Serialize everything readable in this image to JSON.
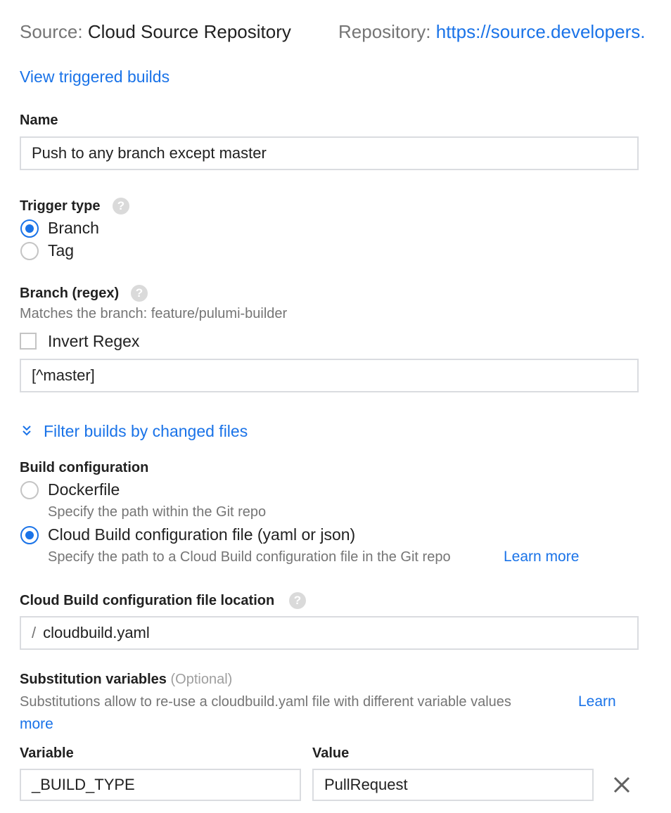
{
  "source": {
    "label": "Source:",
    "value": "Cloud Source Repository",
    "repo_label": "Repository:",
    "repo_link": "https://source.developers."
  },
  "view_builds_link": "View triggered builds",
  "name": {
    "label": "Name",
    "value": "Push to any branch except master"
  },
  "trigger_type": {
    "label": "Trigger type",
    "options": [
      {
        "label": "Branch",
        "selected": true
      },
      {
        "label": "Tag",
        "selected": false
      }
    ]
  },
  "branch": {
    "label": "Branch (regex)",
    "matches": "Matches the branch: feature/pulumi-builder",
    "invert_label": "Invert Regex",
    "invert_checked": false,
    "value": "[^master]"
  },
  "filter_link": "Filter builds by changed files",
  "build_config": {
    "label": "Build configuration",
    "options": [
      {
        "label": "Dockerfile",
        "description": "Specify the path within the Git repo",
        "selected": false
      },
      {
        "label": "Cloud Build configuration file (yaml or json)",
        "description": "Specify the path to a Cloud Build configuration file in the Git repo",
        "selected": true
      }
    ],
    "learn_more": "Learn more"
  },
  "config_location": {
    "label": "Cloud Build configuration file location",
    "prefix": "/",
    "value": "cloudbuild.yaml"
  },
  "substitutions": {
    "label": "Substitution variables",
    "optional": "(Optional)",
    "description": "Substitutions allow to re-use a cloudbuild.yaml file with different variable values",
    "learn": "Learn",
    "more": "more",
    "variable_header": "Variable",
    "value_header": "Value",
    "rows": [
      {
        "variable": "_BUILD_TYPE",
        "value": "PullRequest"
      }
    ]
  },
  "colors": {
    "link": "#1a73e8",
    "radio_selected": "#1a73e8",
    "border": "#dadce0",
    "secondary_text": "#757575"
  }
}
